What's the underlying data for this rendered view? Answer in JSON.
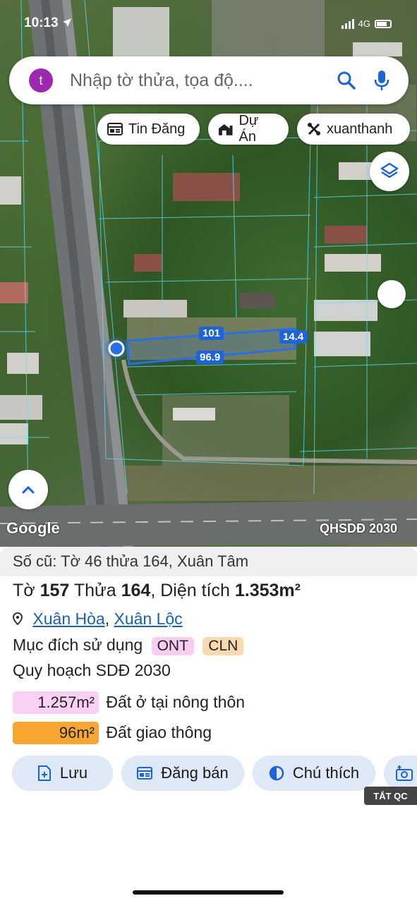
{
  "status_bar": {
    "time": "10:13",
    "network": "4G"
  },
  "search": {
    "avatar_letter": "t",
    "placeholder": "Nhập tờ thửa, tọa độ...."
  },
  "chips": [
    {
      "label": "Tin Đăng",
      "icon": "news-icon"
    },
    {
      "label": "Dự Án",
      "icon": "building-icon"
    },
    {
      "label": "xuanthanh",
      "icon": "tools-icon"
    }
  ],
  "map": {
    "google_label": "Google",
    "overlay_label": "QHSDĐ 2030",
    "parcel_dims": {
      "top": "101",
      "right": "14.4",
      "bottom": "96.9"
    }
  },
  "panel": {
    "old_info": "Số cũ: Tờ 46 thửa 164, Xuân Tâm",
    "parcel": {
      "to_label": "Tờ",
      "to_value": "157",
      "thua_label": "Thửa",
      "thua_value": "164",
      "area_label": ", Diện tích",
      "area_value": "1.353m²"
    },
    "location": {
      "commune": "Xuân Hòa",
      "separator": ",",
      "district": "Xuân Lộc"
    },
    "land_use": {
      "label": "Mục đích sử dụng",
      "tags": [
        {
          "code": "ONT",
          "color": "#f7cdf2"
        },
        {
          "code": "CLN",
          "color": "#f9d9b0"
        }
      ]
    },
    "plan_title": "Quy hoạch SDĐ 2030",
    "plan_items": [
      {
        "area": "1.257m²",
        "desc": "Đất ở tại nông thôn",
        "color": "#fbd0f5"
      },
      {
        "area": "96m²",
        "desc": "Đất giao thông",
        "color": "#f7a731"
      }
    ],
    "buttons": [
      {
        "label": "Lưu",
        "icon": "save-icon"
      },
      {
        "label": "Đăng bán",
        "icon": "listing-icon"
      },
      {
        "label": "Chú thích",
        "icon": "legend-icon"
      }
    ],
    "ad_toggle": "TẮT QC"
  }
}
